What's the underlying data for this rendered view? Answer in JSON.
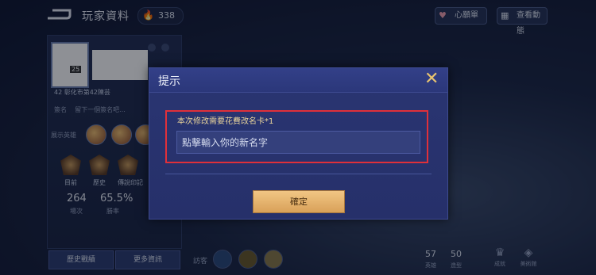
{
  "header": {
    "title": "玩家資料",
    "points": "338",
    "wishlist_label": "心願單",
    "moments_label": "查看動態"
  },
  "profile": {
    "level": "25",
    "rank_text": "42 彰化市第42陳芸",
    "signature_label": "簽名",
    "signature_text": "留下一個簽名吧...",
    "heroes_label": "展示英雄",
    "badges": [
      "目前",
      "歷史",
      "傳說印記"
    ],
    "stats": [
      {
        "value": "264",
        "label": "場次"
      },
      {
        "value": "65.5%",
        "label": "勝率"
      }
    ],
    "buttons": [
      "歷史戰績",
      "更多資訊"
    ]
  },
  "bottom": {
    "visitors_label": "訪客",
    "stats": [
      {
        "value": "57",
        "label": "英雄"
      },
      {
        "value": "50",
        "label": "造型"
      }
    ],
    "icons": [
      {
        "name": "成就",
        "icon": "trophy-icon"
      },
      {
        "name": "美術館",
        "icon": "gallery-icon"
      }
    ]
  },
  "dialog": {
    "title": "提示",
    "close_glyph": "✕",
    "hint": "本次修改需要花費改名卡*1",
    "input_placeholder": "點擊輸入你的新名字",
    "input_value": "",
    "confirm_label": "確定"
  },
  "colors": {
    "accent_gold": "#d9a159",
    "highlight_red": "#e0303a",
    "dialog_bg": "#26306a"
  }
}
